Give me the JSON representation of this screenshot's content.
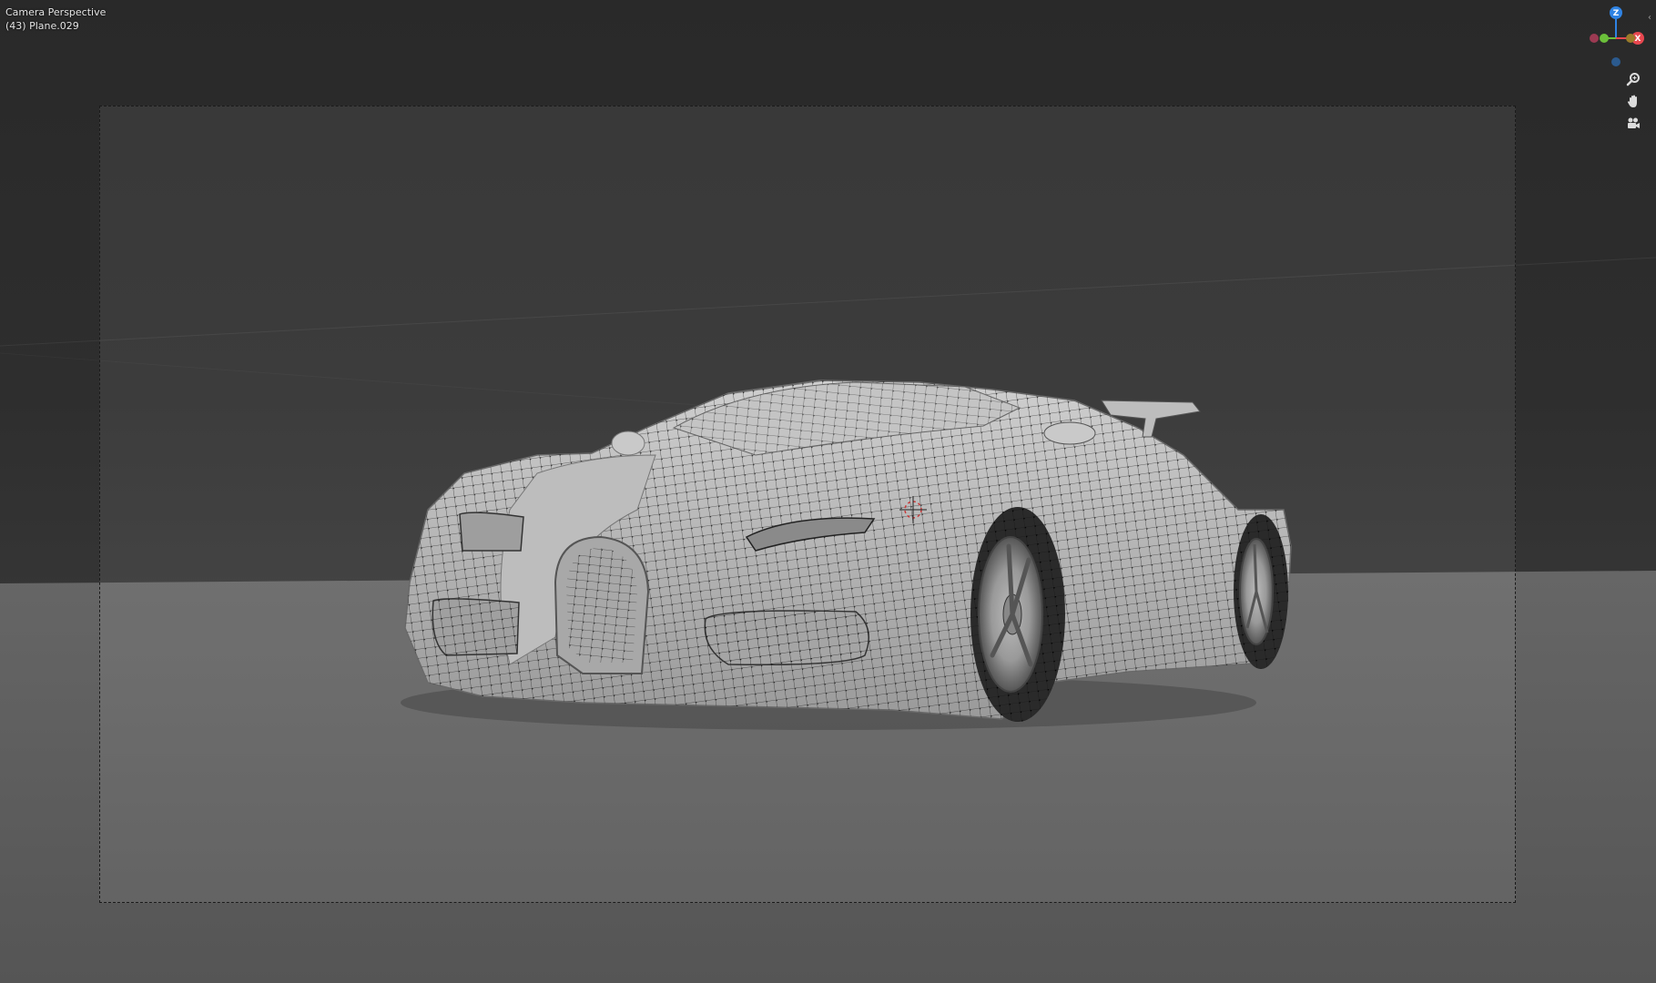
{
  "viewport": {
    "view_name": "Camera Perspective",
    "object_name": "(43) Plane.029"
  },
  "gizmo": {
    "axes": [
      {
        "label": "Z",
        "color": "#2f83e3"
      },
      {
        "label": "X",
        "color": "#e8474f"
      },
      {
        "label": "Y",
        "color": "#6bbf3a"
      }
    ]
  },
  "nav_tools": [
    {
      "name": "zoom",
      "icon": "magnifier-icon"
    },
    {
      "name": "pan",
      "icon": "hand-icon"
    },
    {
      "name": "camera",
      "icon": "camera-icon"
    }
  ],
  "colors": {
    "background": "#2b2b2b",
    "floor": "#5f5f5f",
    "mesh_surface": "#b8b8b8",
    "wire": "#111111"
  }
}
